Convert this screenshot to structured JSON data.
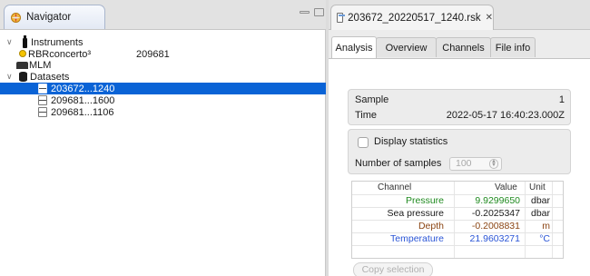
{
  "navigator": {
    "tab_label": "Navigator",
    "tree": [
      {
        "label": "Instruments",
        "value": "",
        "icon": "instrument-icon",
        "kind": "folder"
      },
      {
        "label": "RBRconcerto³",
        "value": "209681",
        "icon": "yellow-dot-icon",
        "kind": "item"
      },
      {
        "label": "MLM",
        "value": "",
        "icon": "mlm-icon",
        "kind": "item"
      },
      {
        "label": "Datasets",
        "value": "",
        "icon": "database-icon",
        "kind": "folder"
      },
      {
        "label": "203672...1240",
        "value": "",
        "icon": "file-icon",
        "kind": "file",
        "selected": true
      },
      {
        "label": "209681...1600",
        "value": "",
        "icon": "file-icon",
        "kind": "file"
      },
      {
        "label": "209681...1106",
        "value": "",
        "icon": "file-icon",
        "kind": "file"
      }
    ]
  },
  "editor": {
    "tab_label": "203672_20220517_1240.rsk",
    "close_glyph": "✕",
    "subtabs": [
      "Analysis",
      "Overview",
      "Channels",
      "File info"
    ],
    "active_subtab": "Analysis"
  },
  "analysis": {
    "sample_label": "Sample",
    "sample_value": "1",
    "time_label": "Time",
    "time_value": "2022-05-17 16:40:23.000Z",
    "display_statistics_label": "Display statistics",
    "display_statistics_checked": false,
    "number_of_samples_label": "Number of samples",
    "number_of_samples_value": "100",
    "table": {
      "headers": [
        "Channel",
        "Value",
        "Unit"
      ],
      "rows": [
        {
          "channel": "Pressure",
          "value": "9.9299650",
          "unit": "dbar",
          "color": "#1f8a1f"
        },
        {
          "channel": "Sea pressure",
          "value": "-0.2025347",
          "unit": "dbar",
          "color": "#1a1a1a"
        },
        {
          "channel": "Depth",
          "value": "-0.2008831",
          "unit": "m",
          "color": "#8b4513"
        },
        {
          "channel": "Temperature",
          "value": "21.9603271",
          "unit": "°C",
          "color": "#2a55d6"
        }
      ]
    },
    "copy_selection_label": "Copy selection"
  }
}
